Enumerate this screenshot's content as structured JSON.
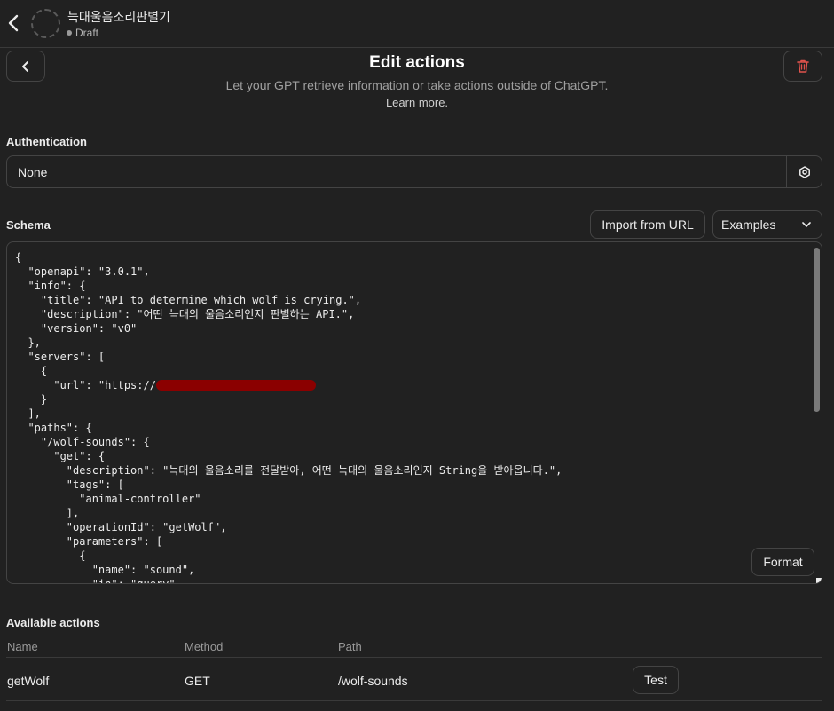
{
  "topbar": {
    "gpt_name": "늑대울음소리판별기",
    "status": "Draft"
  },
  "header": {
    "title": "Edit actions",
    "subtitle": "Let your GPT retrieve information or take actions outside of ChatGPT.",
    "learn_more": "Learn more."
  },
  "authentication": {
    "label": "Authentication",
    "value": "None"
  },
  "schema": {
    "label": "Schema",
    "import_label": "Import from URL",
    "examples_label": "Examples",
    "format_label": "Format",
    "code_before_url": "{\n  \"openapi\": \"3.0.1\",\n  \"info\": {\n    \"title\": \"API to determine which wolf is crying.\",\n    \"description\": \"어떤 늑대의 울음소리인지 판별하는 API.\",\n    \"version\": \"v0\"\n  },\n  \"servers\": [\n    {\n      \"url\": \"https://",
    "code_after_url": "\n    }\n  ],\n  \"paths\": {\n    \"/wolf-sounds\": {\n      \"get\": {\n        \"description\": \"늑대의 울음소리를 전달받아, 어떤 늑대의 울음소리인지 String을 받아옵니다.\",\n        \"tags\": [\n          \"animal-controller\"\n        ],\n        \"operationId\": \"getWolf\",\n        \"parameters\": [\n          {\n            \"name\": \"sound\",\n            \"in\": \"query\","
  },
  "actions": {
    "label": "Available actions",
    "columns": [
      "Name",
      "Method",
      "Path"
    ],
    "rows": [
      {
        "name": "getWolf",
        "method": "GET",
        "path": "/wolf-sounds",
        "test_label": "Test"
      }
    ]
  },
  "colors": {
    "background": "#212121",
    "danger": "#e0524c",
    "redaction": "#8b0000"
  }
}
